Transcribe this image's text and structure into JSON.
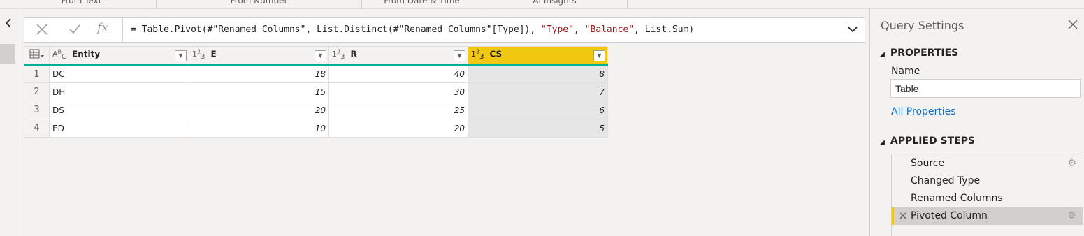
{
  "ribbon": {
    "groups": [
      "From Text",
      "From Number",
      "From Date & Time",
      "AI Insights"
    ]
  },
  "formula_bar": {
    "cancel_icon": "close-icon",
    "commit_icon": "checkmark-icon",
    "fx_label": "fx",
    "prefix": "= Table.Pivot(#\"Renamed Columns\", List.Distinct(#\"Renamed Columns\"[Type]), ",
    "arg1": "\"Type\"",
    "sep": ", ",
    "arg2": "\"Balance\"",
    "suffix": ", List.Sum)"
  },
  "grid": {
    "columns": [
      {
        "type_icon": "ABC",
        "name": "Entity"
      },
      {
        "type_icon": "123",
        "name": "E"
      },
      {
        "type_icon": "123",
        "name": "R"
      },
      {
        "type_icon": "123",
        "name": "CS"
      }
    ],
    "rows": [
      {
        "num": "1",
        "entity": "DC",
        "e": "18",
        "r": "40",
        "cs": "8"
      },
      {
        "num": "2",
        "entity": "DH",
        "e": "15",
        "r": "30",
        "cs": "7"
      },
      {
        "num": "3",
        "entity": "DS",
        "e": "20",
        "r": "25",
        "cs": "6"
      },
      {
        "num": "4",
        "entity": "ED",
        "e": "10",
        "r": "20",
        "cs": "5"
      }
    ],
    "selected_column": "CS",
    "colors": {
      "selected_header": "#f2c811",
      "quality_bar": "#00b294"
    }
  },
  "query_settings": {
    "title": "Query Settings",
    "properties_heading": "PROPERTIES",
    "name_label": "Name",
    "name_value": "Table",
    "all_properties": "All Properties",
    "applied_steps_heading": "APPLIED STEPS",
    "steps": [
      "Source",
      "Changed Type",
      "Renamed Columns",
      "Pivoted Column"
    ],
    "active_step": "Pivoted Column"
  }
}
